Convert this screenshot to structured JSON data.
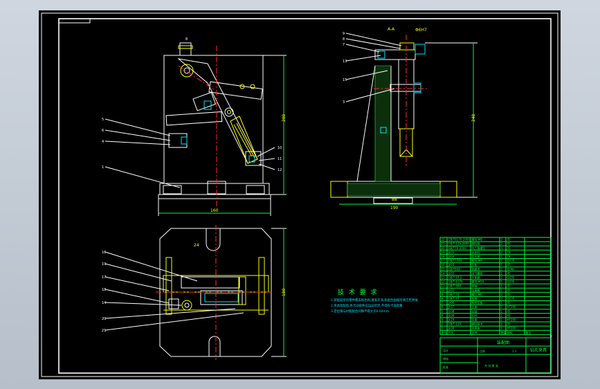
{
  "drawing": {
    "section_marker": "A-A",
    "tech_requirements": {
      "title": "技 术 要 求",
      "items": [
        "1.装配前所有零件需去除毛刺,清洗干净,各配合面保持清洁无锈蚀.",
        "2.夹具装配后,各活动部件应运动灵活,不得有卡滞现象.",
        "3.定位销与衬套配合间隙不得大于0.02mm."
      ]
    },
    "dimensions": {
      "front_height": "280",
      "front_width": "160",
      "side_height": "248",
      "side_width": "190",
      "side_base": "88",
      "top_depth": "180",
      "top_slot": "24"
    },
    "leaders_front": [
      "5",
      "6",
      "4",
      "1",
      "10",
      "11",
      "12",
      "8"
    ],
    "leaders_side": [
      "9",
      "8",
      "7",
      "13",
      "15",
      "3"
    ],
    "leaders_top": [
      "16",
      "19",
      "17",
      "18",
      "14",
      "20",
      "21"
    ],
    "bom_header": [
      "序号",
      "代号",
      "名称",
      "数量",
      "材料",
      "备注"
    ],
    "bom_rows": [
      [
        "22",
        "GB/T6170-2000",
        "螺母 M8",
        "2",
        "45",
        ""
      ],
      [
        "21",
        "GB/T 119-2000",
        "圆柱销",
        "2",
        "45",
        ""
      ],
      [
        "20",
        "GB/T70-2000",
        "内六角螺钉",
        "4",
        "35",
        ""
      ],
      [
        "19",
        "JJ-05",
        "支承钉",
        "2",
        "T8",
        ""
      ],
      [
        "18",
        "JJ-04",
        "定位销",
        "1",
        "T8",
        ""
      ],
      [
        "17",
        "GB/T5783",
        "螺栓 M8",
        "1",
        "Q235",
        ""
      ],
      [
        "16",
        "JJ-03",
        "压板",
        "1",
        "45",
        ""
      ],
      [
        "15",
        "GB/T848",
        "垫圈 8",
        "2",
        "65Mn",
        ""
      ],
      [
        "14",
        "JJ-02",
        "活节螺栓",
        "1",
        "45",
        ""
      ],
      [
        "13",
        "GB/T 97.1",
        "平垫圈",
        "2",
        "Q235",
        ""
      ],
      [
        "12",
        "GB/T 6170",
        "螺母 M10",
        "1",
        "Q235",
        ""
      ],
      [
        "11",
        "GB/T 880",
        "销轴",
        "1",
        "45",
        ""
      ],
      [
        "10",
        "JJ-01",
        "连接板",
        "1",
        "45",
        ""
      ],
      [
        "9",
        "GB/T 70",
        "螺钉 M6",
        "2",
        "35",
        ""
      ],
      [
        "8",
        "GB/T 97",
        "垫圈",
        "2",
        "Q235",
        ""
      ],
      [
        "7",
        "JJ-06",
        "钩形压板",
        "1",
        "45",
        ""
      ],
      [
        "6",
        "JJ-07",
        "支座",
        "1",
        "HT200",
        ""
      ],
      [
        "5",
        "JJ-08",
        "铰链",
        "1",
        "45",
        ""
      ],
      [
        "4",
        "JJ-09",
        "杠杆",
        "1",
        "45",
        ""
      ],
      [
        "3",
        "JJ-10",
        "支架",
        "1",
        "HT200",
        ""
      ],
      [
        "2",
        "GB/T 119",
        "圆柱销 6",
        "2",
        "35",
        ""
      ],
      [
        "1",
        "JJ-00",
        "夹具体",
        "1",
        "HT200",
        ""
      ]
    ],
    "title_block": {
      "assembly_name": "装配图",
      "part_name": "钻孔夹具",
      "scale_label": "比例",
      "scale": "1:1",
      "sheet_label": "共 张 第 张",
      "designer": "设计",
      "checker": "审核",
      "approver": "批准"
    }
  }
}
